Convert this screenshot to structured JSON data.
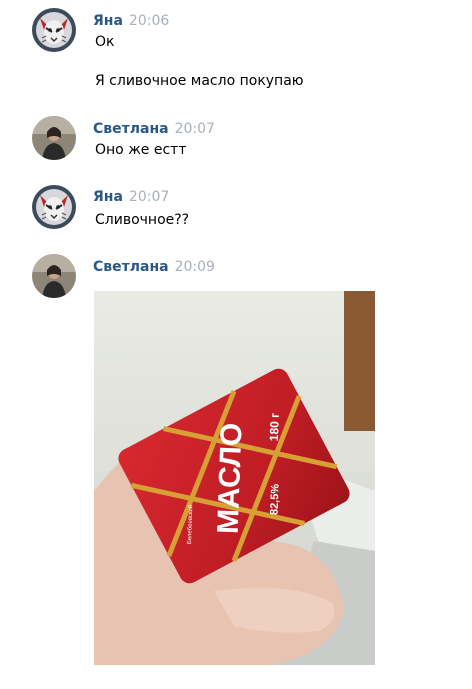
{
  "messages": [
    {
      "author": "Яна",
      "time": "20:06",
      "lines": [
        "Ок",
        "Я сливочное масло покупаю"
      ],
      "avatar": "tiger-avatar"
    },
    {
      "author": "Светлана",
      "time": "20:07",
      "lines": [
        "Оно же естт"
      ],
      "avatar": "person-avatar"
    },
    {
      "author": "Яна",
      "time": "20:07",
      "lines": [
        "Сливочное??"
      ],
      "avatar": "tiger-avatar"
    },
    {
      "author": "Светлана",
      "time": "20:09",
      "lines": [],
      "avatar": "person-avatar",
      "attachment": "photo"
    }
  ],
  "photo": {
    "package_brand": "МАСЛО",
    "package_weight": "180 г",
    "package_fat": "82,5%",
    "package_subtitle": "сладкосливочное несоленое",
    "package_logo": "Белебеевский"
  },
  "colors": {
    "author": "#2a5885",
    "time": "#a9b0b8",
    "package": "#c8202a",
    "stripe": "#d6a035"
  }
}
